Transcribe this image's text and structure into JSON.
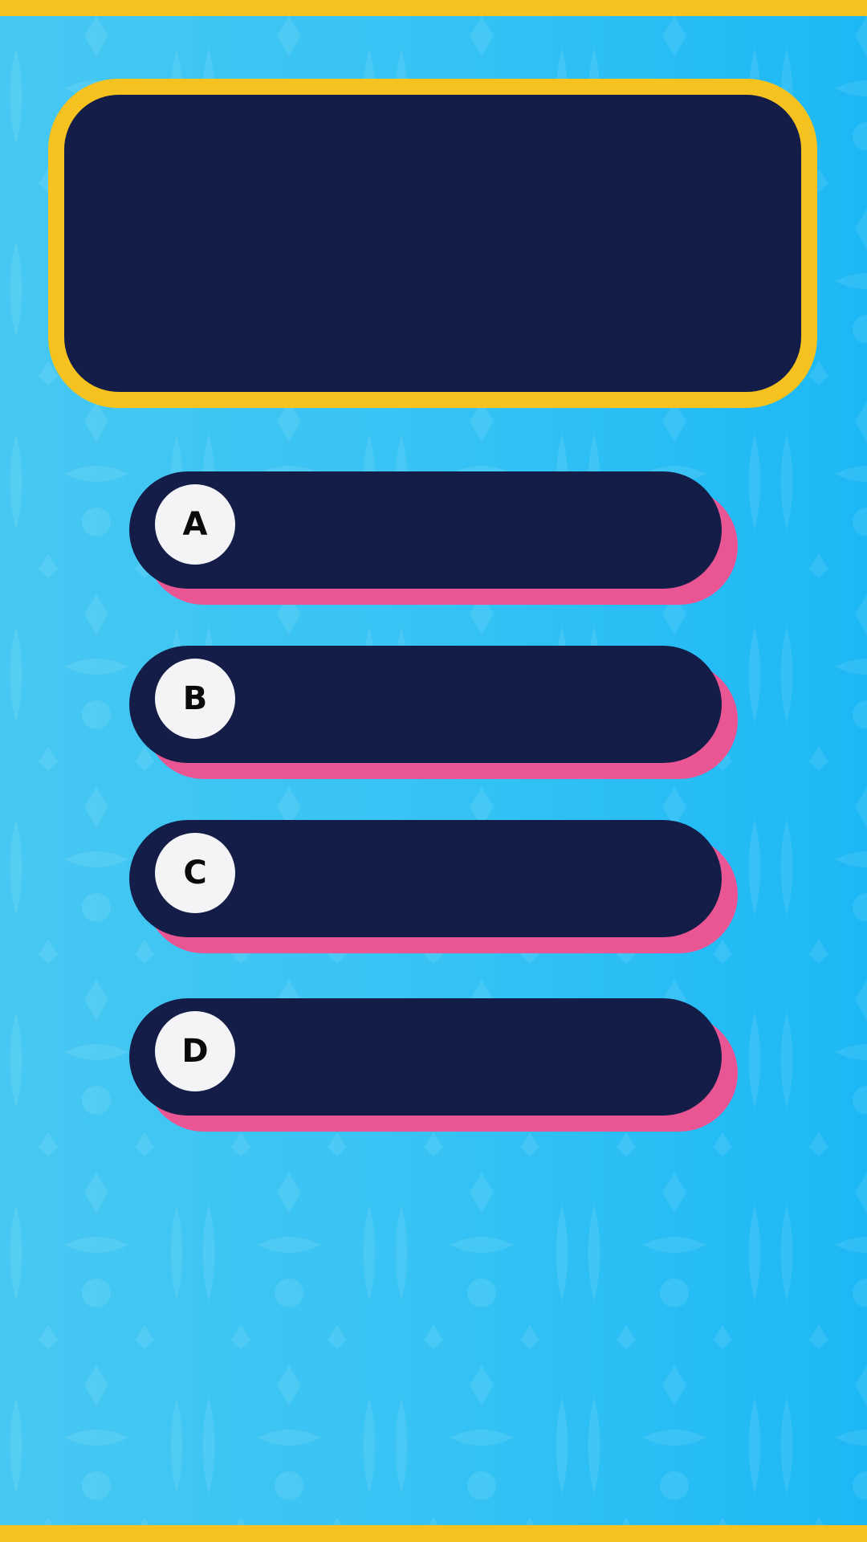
{
  "colors": {
    "frame_yellow": "#f5c220",
    "panel_navy": "#131d47",
    "shadow_pink": "#ea5594",
    "background_blue": "#36c3f4",
    "badge_white": "#f4f4f6"
  },
  "question": {
    "text": ""
  },
  "answers": [
    {
      "letter": "A",
      "text": ""
    },
    {
      "letter": "B",
      "text": ""
    },
    {
      "letter": "C",
      "text": ""
    },
    {
      "letter": "D",
      "text": ""
    }
  ]
}
